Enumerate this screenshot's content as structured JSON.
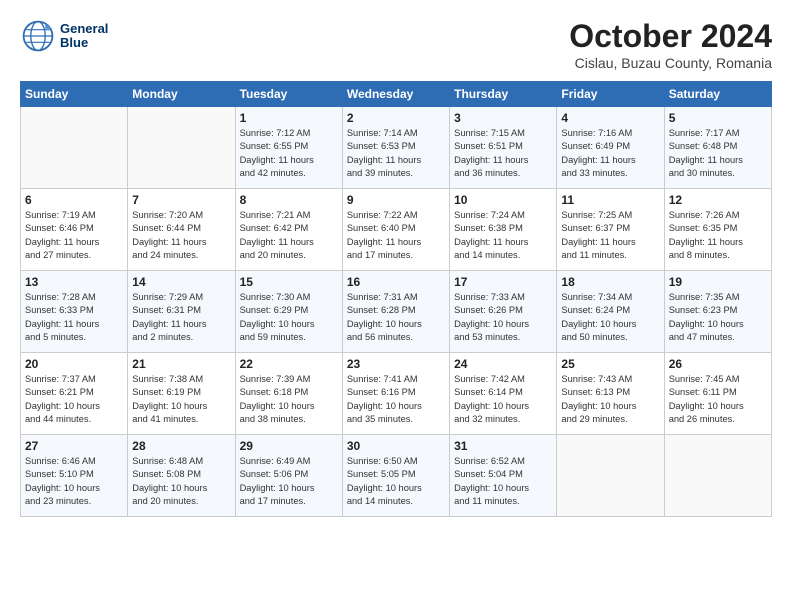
{
  "logo": {
    "line1": "General",
    "line2": "Blue"
  },
  "title": "October 2024",
  "subtitle": "Cislau, Buzau County, Romania",
  "days_of_week": [
    "Sunday",
    "Monday",
    "Tuesday",
    "Wednesday",
    "Thursday",
    "Friday",
    "Saturday"
  ],
  "weeks": [
    [
      {
        "day": "",
        "info": ""
      },
      {
        "day": "",
        "info": ""
      },
      {
        "day": "1",
        "info": "Sunrise: 7:12 AM\nSunset: 6:55 PM\nDaylight: 11 hours\nand 42 minutes."
      },
      {
        "day": "2",
        "info": "Sunrise: 7:14 AM\nSunset: 6:53 PM\nDaylight: 11 hours\nand 39 minutes."
      },
      {
        "day": "3",
        "info": "Sunrise: 7:15 AM\nSunset: 6:51 PM\nDaylight: 11 hours\nand 36 minutes."
      },
      {
        "day": "4",
        "info": "Sunrise: 7:16 AM\nSunset: 6:49 PM\nDaylight: 11 hours\nand 33 minutes."
      },
      {
        "day": "5",
        "info": "Sunrise: 7:17 AM\nSunset: 6:48 PM\nDaylight: 11 hours\nand 30 minutes."
      }
    ],
    [
      {
        "day": "6",
        "info": "Sunrise: 7:19 AM\nSunset: 6:46 PM\nDaylight: 11 hours\nand 27 minutes."
      },
      {
        "day": "7",
        "info": "Sunrise: 7:20 AM\nSunset: 6:44 PM\nDaylight: 11 hours\nand 24 minutes."
      },
      {
        "day": "8",
        "info": "Sunrise: 7:21 AM\nSunset: 6:42 PM\nDaylight: 11 hours\nand 20 minutes."
      },
      {
        "day": "9",
        "info": "Sunrise: 7:22 AM\nSunset: 6:40 PM\nDaylight: 11 hours\nand 17 minutes."
      },
      {
        "day": "10",
        "info": "Sunrise: 7:24 AM\nSunset: 6:38 PM\nDaylight: 11 hours\nand 14 minutes."
      },
      {
        "day": "11",
        "info": "Sunrise: 7:25 AM\nSunset: 6:37 PM\nDaylight: 11 hours\nand 11 minutes."
      },
      {
        "day": "12",
        "info": "Sunrise: 7:26 AM\nSunset: 6:35 PM\nDaylight: 11 hours\nand 8 minutes."
      }
    ],
    [
      {
        "day": "13",
        "info": "Sunrise: 7:28 AM\nSunset: 6:33 PM\nDaylight: 11 hours\nand 5 minutes."
      },
      {
        "day": "14",
        "info": "Sunrise: 7:29 AM\nSunset: 6:31 PM\nDaylight: 11 hours\nand 2 minutes."
      },
      {
        "day": "15",
        "info": "Sunrise: 7:30 AM\nSunset: 6:29 PM\nDaylight: 10 hours\nand 59 minutes."
      },
      {
        "day": "16",
        "info": "Sunrise: 7:31 AM\nSunset: 6:28 PM\nDaylight: 10 hours\nand 56 minutes."
      },
      {
        "day": "17",
        "info": "Sunrise: 7:33 AM\nSunset: 6:26 PM\nDaylight: 10 hours\nand 53 minutes."
      },
      {
        "day": "18",
        "info": "Sunrise: 7:34 AM\nSunset: 6:24 PM\nDaylight: 10 hours\nand 50 minutes."
      },
      {
        "day": "19",
        "info": "Sunrise: 7:35 AM\nSunset: 6:23 PM\nDaylight: 10 hours\nand 47 minutes."
      }
    ],
    [
      {
        "day": "20",
        "info": "Sunrise: 7:37 AM\nSunset: 6:21 PM\nDaylight: 10 hours\nand 44 minutes."
      },
      {
        "day": "21",
        "info": "Sunrise: 7:38 AM\nSunset: 6:19 PM\nDaylight: 10 hours\nand 41 minutes."
      },
      {
        "day": "22",
        "info": "Sunrise: 7:39 AM\nSunset: 6:18 PM\nDaylight: 10 hours\nand 38 minutes."
      },
      {
        "day": "23",
        "info": "Sunrise: 7:41 AM\nSunset: 6:16 PM\nDaylight: 10 hours\nand 35 minutes."
      },
      {
        "day": "24",
        "info": "Sunrise: 7:42 AM\nSunset: 6:14 PM\nDaylight: 10 hours\nand 32 minutes."
      },
      {
        "day": "25",
        "info": "Sunrise: 7:43 AM\nSunset: 6:13 PM\nDaylight: 10 hours\nand 29 minutes."
      },
      {
        "day": "26",
        "info": "Sunrise: 7:45 AM\nSunset: 6:11 PM\nDaylight: 10 hours\nand 26 minutes."
      }
    ],
    [
      {
        "day": "27",
        "info": "Sunrise: 6:46 AM\nSunset: 5:10 PM\nDaylight: 10 hours\nand 23 minutes."
      },
      {
        "day": "28",
        "info": "Sunrise: 6:48 AM\nSunset: 5:08 PM\nDaylight: 10 hours\nand 20 minutes."
      },
      {
        "day": "29",
        "info": "Sunrise: 6:49 AM\nSunset: 5:06 PM\nDaylight: 10 hours\nand 17 minutes."
      },
      {
        "day": "30",
        "info": "Sunrise: 6:50 AM\nSunset: 5:05 PM\nDaylight: 10 hours\nand 14 minutes."
      },
      {
        "day": "31",
        "info": "Sunrise: 6:52 AM\nSunset: 5:04 PM\nDaylight: 10 hours\nand 11 minutes."
      },
      {
        "day": "",
        "info": ""
      },
      {
        "day": "",
        "info": ""
      }
    ]
  ]
}
